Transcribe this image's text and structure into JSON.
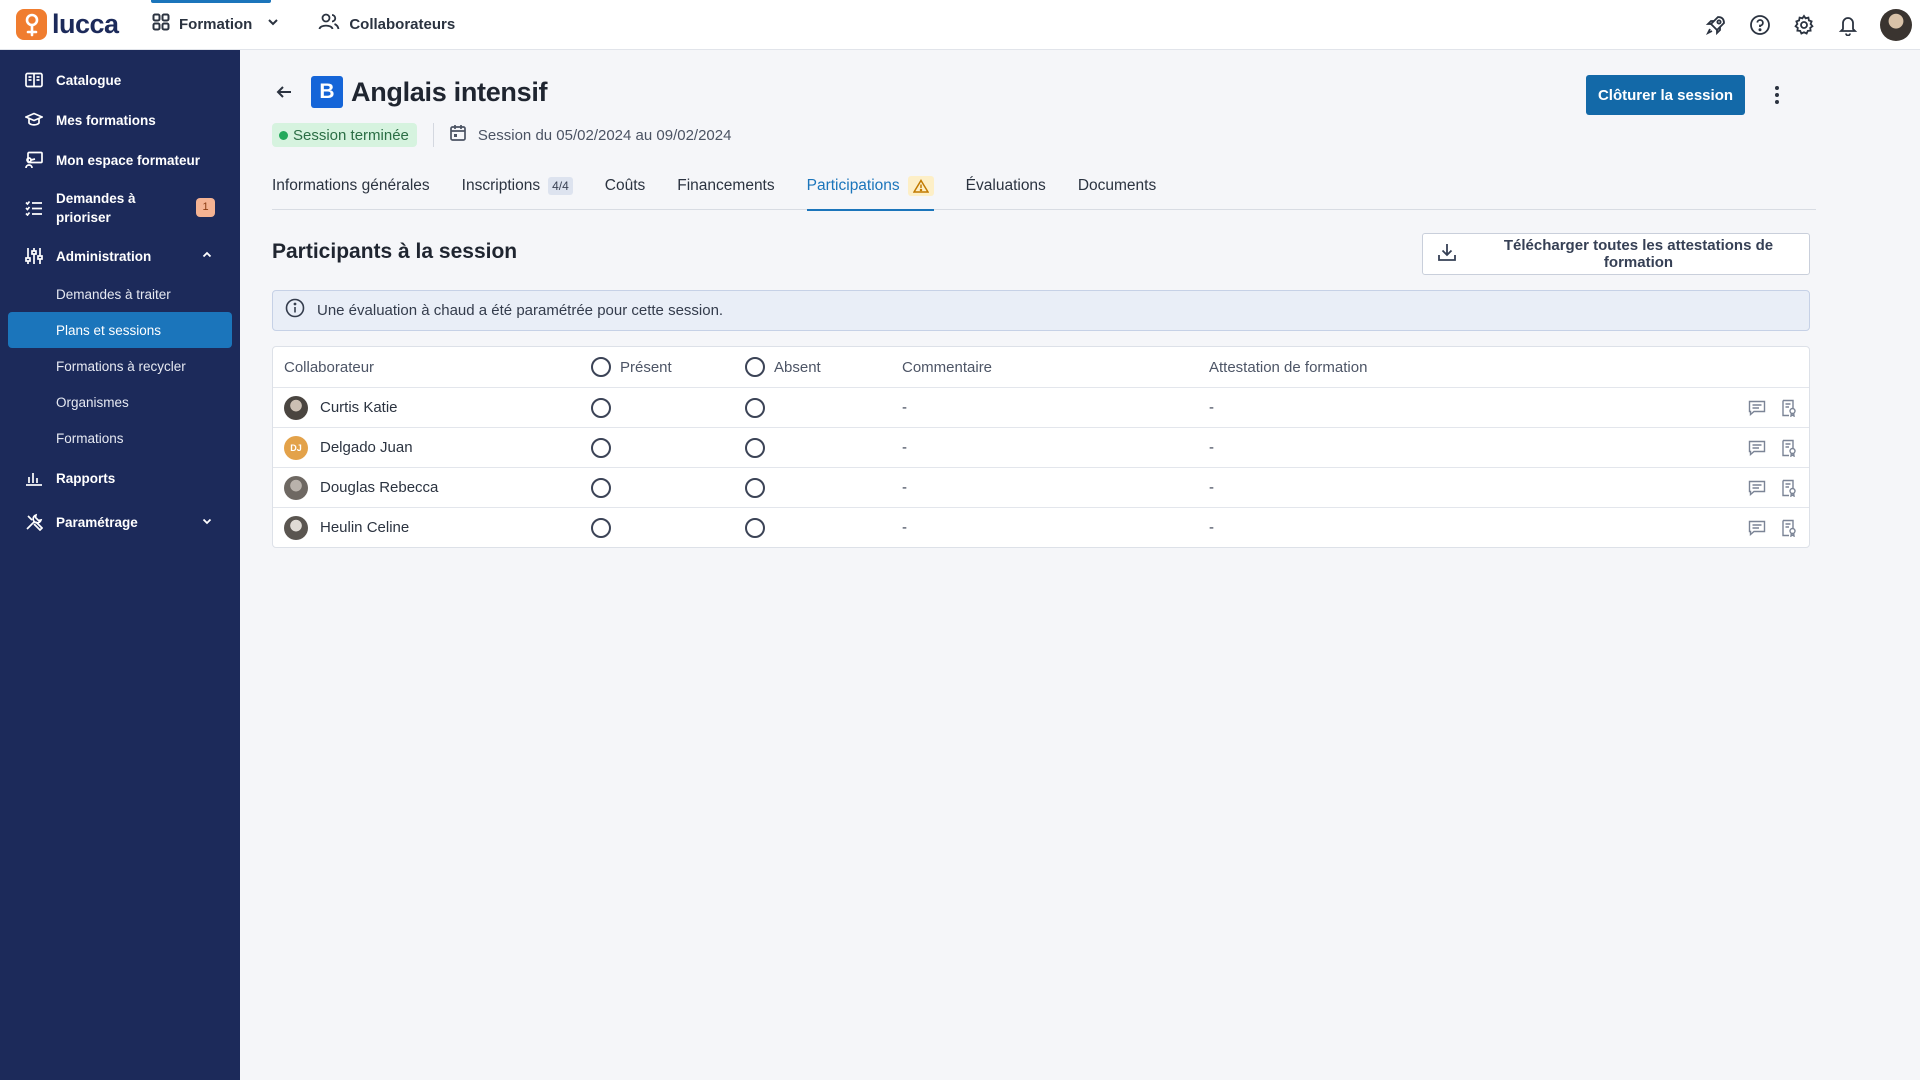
{
  "app": {
    "name": "lucca"
  },
  "topnav": {
    "module": "Formation",
    "people": "Collaborateurs"
  },
  "sidebar": {
    "items": [
      {
        "label": "Catalogue",
        "icon": "book-open-icon"
      },
      {
        "label": "Mes formations",
        "icon": "graduation-cap-icon"
      },
      {
        "label": "Mon espace formateur",
        "icon": "presentation-board-icon"
      },
      {
        "label": "Demandes à prioriser",
        "icon": "list-check-icon",
        "badge": "1"
      },
      {
        "label": "Administration",
        "icon": "sliders-icon",
        "expanded": true
      },
      {
        "label": "Rapports",
        "icon": "bar-chart-icon"
      },
      {
        "label": "Paramétrage",
        "icon": "tools-icon",
        "expanded": false
      }
    ],
    "admin_sub": [
      {
        "label": "Demandes à traiter"
      },
      {
        "label": "Plans et sessions",
        "active": true
      },
      {
        "label": "Formations à recycler"
      },
      {
        "label": "Organismes"
      },
      {
        "label": "Formations"
      }
    ]
  },
  "page": {
    "badge_letter": "B",
    "title": "Anglais intensif",
    "status": "Session terminée",
    "session_dates": "Session du 05/02/2024 au 09/02/2024",
    "close_button": "Clôturer la session"
  },
  "tabs": [
    {
      "label": "Informations générales"
    },
    {
      "label": "Inscriptions",
      "count": "4/4"
    },
    {
      "label": "Coûts"
    },
    {
      "label": "Financements"
    },
    {
      "label": "Participations",
      "warning": true,
      "active": true
    },
    {
      "label": "Évaluations"
    },
    {
      "label": "Documents"
    }
  ],
  "section": {
    "title": "Participants à la session",
    "download_button": "Télécharger toutes les attestations de formation",
    "info": "Une évaluation à chaud a été paramétrée pour cette session."
  },
  "table": {
    "headers": {
      "collaborator": "Collaborateur",
      "present": "Présent",
      "absent": "Absent",
      "comment": "Commentaire",
      "attestation": "Attestation de formation"
    },
    "rows": [
      {
        "name": "Curtis Katie",
        "initials": "",
        "comment": "-",
        "attestation": "-"
      },
      {
        "name": "Delgado Juan",
        "initials": "DJ",
        "comment": "-",
        "attestation": "-"
      },
      {
        "name": "Douglas Rebecca",
        "initials": "",
        "comment": "-",
        "attestation": "-"
      },
      {
        "name": "Heulin Celine",
        "initials": "",
        "comment": "-",
        "attestation": "-"
      }
    ]
  },
  "colors": {
    "sidebar_bg": "#1c2a5a",
    "accent": "#1b75bb",
    "primary_button": "#1369a8",
    "status_green": "#23a95b",
    "logo_orange": "#f07d2f"
  }
}
